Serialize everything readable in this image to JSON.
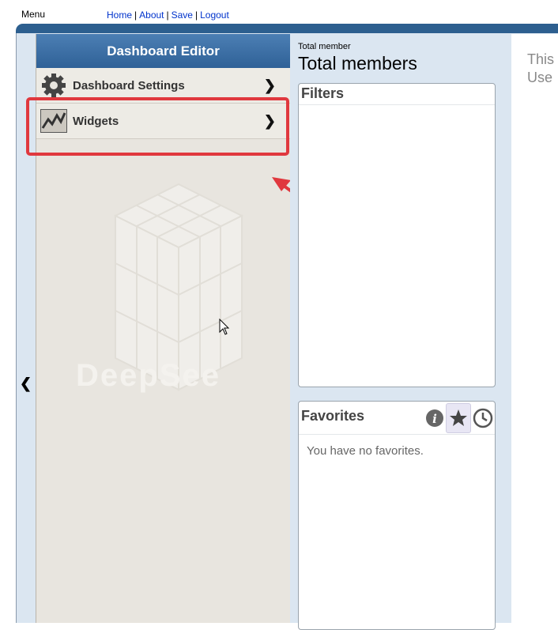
{
  "nav": {
    "menu": "Menu",
    "links": [
      "Home",
      "About",
      "Save",
      "Logout"
    ]
  },
  "editor": {
    "title": "Dashboard Editor",
    "items": [
      {
        "label": "Dashboard Settings",
        "icon": "gear-icon"
      },
      {
        "label": "Widgets",
        "icon": "chart-line-icon"
      }
    ],
    "watermark": "DeepSee"
  },
  "main": {
    "subtitle": "Total member",
    "title": "Total members",
    "filters_title": "Filters",
    "favorites_title": "Favorites",
    "favorites_empty": "You have no favorites."
  },
  "right": {
    "line1": "This",
    "line2": "Use"
  },
  "colors": {
    "header": "#2f6197",
    "highlight": "#e0383e",
    "link": "#0033cc"
  }
}
